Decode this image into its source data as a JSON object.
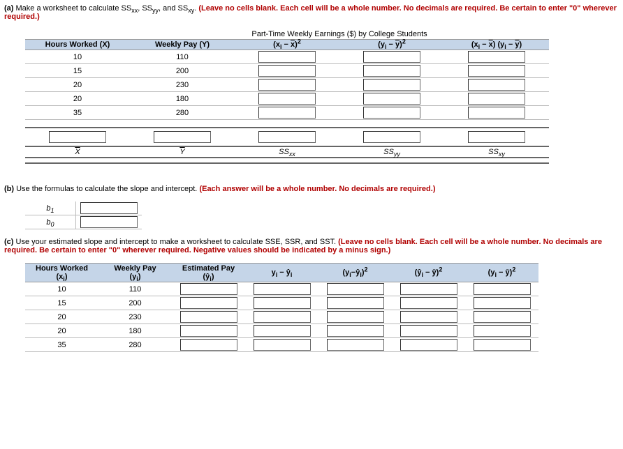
{
  "partA": {
    "label": "(a)",
    "text": "Make a worksheet to calculate SS",
    "ss1_sub": "xx",
    "ss2_pre": ", SS",
    "ss2_sub": "yy",
    "ss3_pre": ", and SS",
    "ss3_sub": "xy",
    "red": "(Leave no cells blank.  Each cell will be a whole number.  No decimals are required. Be certain to enter \"0\" wherever required.)"
  },
  "tableA": {
    "caption": "Part-Time Weekly Earnings ($) by College Students",
    "headers": {
      "c1": "Hours Worked (X)",
      "c2": "Weekly Pay (Y)",
      "c3a": "(x",
      "c3b": "i",
      "c3c": " − ",
      "c3d": "x",
      "c3e": ")",
      "c3f": "2",
      "c4a": "(y",
      "c4b": "i",
      "c4c": " − ",
      "c4d": "y",
      "c4e": ")",
      "c4f": "2",
      "c5a": "(x",
      "c5b": "i",
      "c5c": " − ",
      "c5d": "x",
      "c5e": ") (y",
      "c5f": "i",
      "c5g": " − ",
      "c5h": "y",
      "c5i": ")"
    },
    "rows": [
      {
        "x": "10",
        "y": "110"
      },
      {
        "x": "15",
        "y": "200"
      },
      {
        "x": "20",
        "y": "230"
      },
      {
        "x": "20",
        "y": "180"
      },
      {
        "x": "35",
        "y": "280"
      }
    ],
    "sumlabels": {
      "c1": "x̄",
      "c2": "ȳ",
      "c3": "SSxx",
      "c4": "SSyy",
      "c5": "SSxy"
    }
  },
  "partB": {
    "label": "(b)",
    "text": "Use the formulas to calculate the slope and intercept. ",
    "red": "(Each answer will be a whole number.  No decimals are required.)",
    "b1": "b",
    "b1sub": "1",
    "b0": "b",
    "b0sub": "0"
  },
  "partC": {
    "label": "(c)",
    "text": "Use your estimated slope and intercept to make a worksheet to calculate SSE, SSR, and SST. ",
    "red": "(Leave no cells blank. Each cell will be a whole number.  No decimals are required.  Be certain to enter \"0\" wherever required. Negative values should be indicated by a minus sign.)"
  },
  "tableC": {
    "headers": {
      "c1a": "Hours Worked",
      "c1b": "(x",
      "c1c": "i",
      "c1d": ")",
      "c2a": "Weekly Pay",
      "c2b": "(y",
      "c2c": "i",
      "c2d": ")",
      "c3a": "Estimated Pay",
      "c3p": "(",
      "c3b": "ŷ",
      "c3c": "i",
      "c3d": ")",
      "c4a": "y",
      "c4b": "i",
      "c4c": " − ",
      "c4d": "ŷ",
      "c4e": "i",
      "c5a": "(y",
      "c5b": "i",
      "c5c": "−",
      "c5d": "ŷ",
      "c5e": "i",
      "c5f": ")",
      "c5g": "2",
      "c6a": "(",
      "c6b": "ŷ",
      "c6c": "i",
      "c6d": " − ",
      "c6e": "ȳ",
      "c6f": ")",
      "c6g": "2",
      "c7a": "(y",
      "c7b": "i",
      "c7c": " − ",
      "c7d": "ȳ",
      "c7e": ")",
      "c7f": "2"
    },
    "rows": [
      {
        "x": "10",
        "y": "110"
      },
      {
        "x": "15",
        "y": "200"
      },
      {
        "x": "20",
        "y": "230"
      },
      {
        "x": "20",
        "y": "180"
      },
      {
        "x": "35",
        "y": "280"
      }
    ]
  }
}
